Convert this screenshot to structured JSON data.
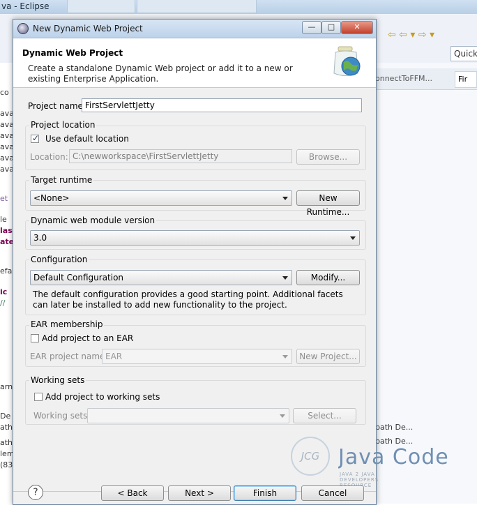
{
  "eclipse": {
    "window_title": "va - Eclipse",
    "quick_access": "Quick",
    "right_tabs": [
      "onnectToFFM...",
      "Fir"
    ],
    "right_lines": [
      "path De...",
      "path De..."
    ]
  },
  "dialog": {
    "title": "New Dynamic Web Project",
    "banner": {
      "heading": "Dynamic Web Project",
      "description": "Create a standalone Dynamic Web project or add it to a new or existing Enterprise Application."
    },
    "project_name": {
      "label": "Project name:",
      "value": "FirstServlettJetty"
    },
    "project_location": {
      "title": "Project location",
      "use_default_label": "Use default location",
      "use_default_checked": true,
      "location_label": "Location:",
      "location_value": "C:\\newworkspace\\FirstServlettJetty",
      "browse_label": "Browse..."
    },
    "target_runtime": {
      "title": "Target runtime",
      "value": "<None>",
      "new_runtime_label": "New Runtime..."
    },
    "module_version": {
      "title": "Dynamic web module version",
      "value": "3.0"
    },
    "configuration": {
      "title": "Configuration",
      "value": "Default Configuration",
      "modify_label": "Modify...",
      "description": "The default configuration provides a good starting point. Additional facets can later be installed to add new functionality to the project."
    },
    "ear": {
      "title": "EAR membership",
      "add_label": "Add project to an EAR",
      "add_checked": false,
      "project_name_label": "EAR project name:",
      "project_name_value": "EAR",
      "new_project_label": "New Project..."
    },
    "working_sets": {
      "title": "Working sets",
      "add_label": "Add project to working sets",
      "add_checked": false,
      "sets_label": "Working sets:",
      "sets_value": "",
      "select_label": "Select..."
    },
    "buttons": {
      "help": "?",
      "back": "< Back",
      "next": "Next >",
      "finish": "Finish",
      "cancel": "Cancel"
    }
  },
  "watermark": {
    "monogram": "JCG",
    "name": "Java Code Geeks",
    "tagline": "JAVA 2 JAVA DEVELOPERS RESOURCE CENTER"
  },
  "colors": {
    "accent": "#3c7fb1",
    "title_gradient_top": "#d8e6f4",
    "close_button": "#c2402a"
  }
}
